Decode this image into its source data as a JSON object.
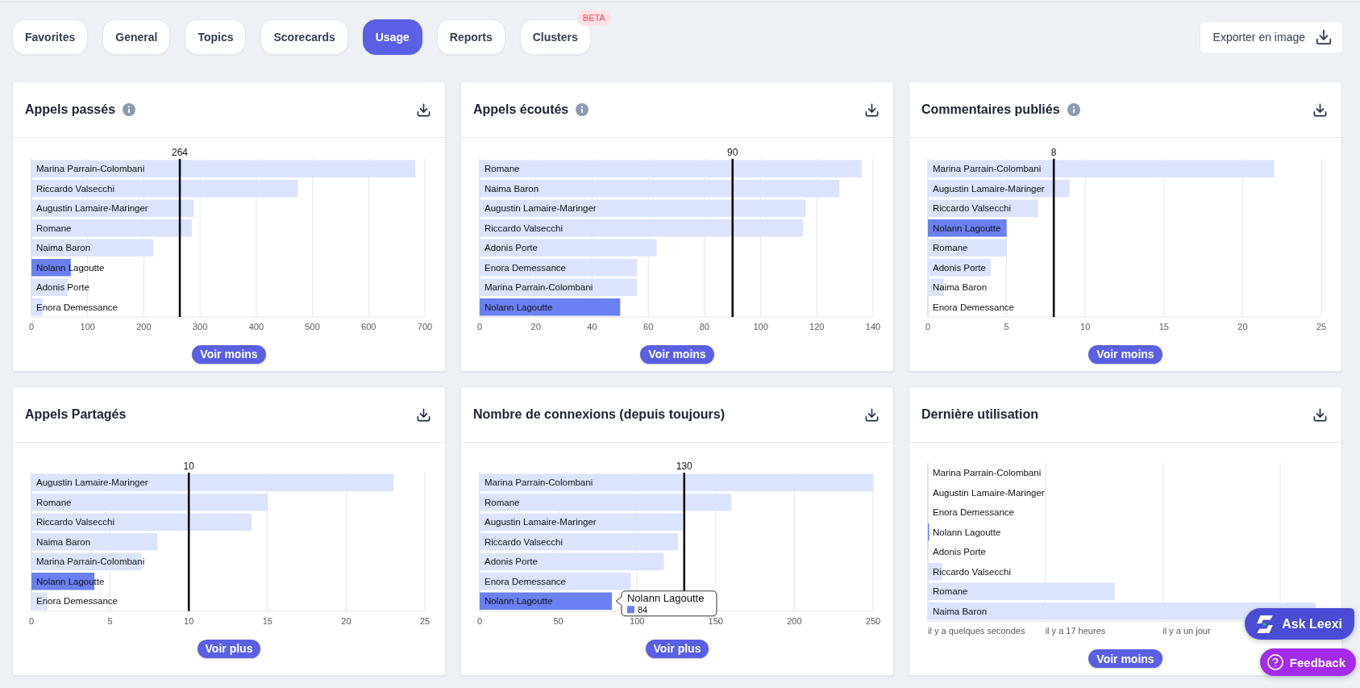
{
  "tabs": [
    {
      "label": "Favorites",
      "selected": false
    },
    {
      "label": "General",
      "selected": false
    },
    {
      "label": "Topics",
      "selected": false
    },
    {
      "label": "Scorecards",
      "selected": false
    },
    {
      "label": "Usage",
      "selected": true
    },
    {
      "label": "Reports",
      "selected": false
    },
    {
      "label": "Clusters",
      "selected": false,
      "badge": "BETA"
    }
  ],
  "export_button": {
    "label": "Exporter en image"
  },
  "cards": [
    {
      "title": "Appels passés",
      "info_icon": true,
      "chart_data": {
        "type": "bar",
        "orientation": "horizontal",
        "grid": true,
        "categories": [
          "Marina Parrain-Colombani",
          "Riccardo Valsecchi",
          "Augustin Lamaire-Maringer",
          "Romane",
          "Naima Baron",
          "Nolann Lagoutte",
          "Adonis Porte",
          "Enora Demessance"
        ],
        "series": [
          {
            "color": "#dbe3fd",
            "values": [
              683,
              474,
              289,
              285,
              217,
              null,
              64,
              20
            ]
          },
          {
            "color": "#6b80f2",
            "values": [
              null,
              null,
              null,
              null,
              null,
              70,
              null,
              null
            ]
          }
        ],
        "xlim": [
          0,
          700
        ],
        "xticks": [
          0,
          100,
          200,
          300,
          400,
          500,
          600,
          700
        ],
        "ref_lines": [
          {
            "axis": "x",
            "value": 264,
            "label": "264"
          }
        ]
      },
      "toggle": "Voir moins"
    },
    {
      "title": "Appels écoutés",
      "info_icon": true,
      "chart_data": {
        "type": "bar",
        "orientation": "horizontal",
        "grid": true,
        "categories": [
          "Romane",
          "Naima Baron",
          "Augustin Lamaire-Maringer",
          "Riccardo Valsecchi",
          "Adonis Porte",
          "Enora Demessance",
          "Marina Parrain-Colombani",
          "Nolann Lagoutte"
        ],
        "series": [
          {
            "color": "#dbe3fd",
            "values": [
              136,
              128,
              116,
              115,
              63,
              56,
              56,
              null
            ]
          },
          {
            "color": "#6b80f2",
            "values": [
              null,
              null,
              null,
              null,
              null,
              null,
              null,
              50
            ]
          }
        ],
        "xlim": [
          0,
          140
        ],
        "xticks": [
          0,
          20,
          40,
          60,
          80,
          100,
          120,
          140
        ],
        "ref_lines": [
          {
            "axis": "x",
            "value": 90,
            "label": "90"
          }
        ]
      },
      "toggle": "Voir moins"
    },
    {
      "title": "Commentaires publiés",
      "info_icon": true,
      "chart_data": {
        "type": "bar",
        "orientation": "horizontal",
        "grid": true,
        "categories": [
          "Marina Parrain-Colombani",
          "Augustin Lamaire-Maringer",
          "Riccardo Valsecchi",
          "Nolann Lagoutte",
          "Romane",
          "Adonis Porte",
          "Naima Baron",
          "Enora Demessance"
        ],
        "series": [
          {
            "color": "#dbe3fd",
            "values": [
              22,
              9,
              7,
              null,
              5,
              4,
              1,
              0
            ]
          },
          {
            "color": "#6b80f2",
            "values": [
              null,
              null,
              null,
              5,
              null,
              null,
              null,
              null
            ]
          }
        ],
        "xlim": [
          0,
          25
        ],
        "xticks": [
          0,
          5,
          10,
          15,
          20,
          25
        ],
        "ref_lines": [
          {
            "axis": "x",
            "value": 8,
            "label": "8"
          }
        ]
      },
      "toggle": "Voir moins"
    },
    {
      "title": "Appels Partagés",
      "info_icon": false,
      "chart_data": {
        "type": "bar",
        "orientation": "horizontal",
        "grid": true,
        "categories": [
          "Augustin Lamaire-Maringer",
          "Romane",
          "Riccardo Valsecchi",
          "Naima Baron",
          "Marina Parrain-Colombani",
          "Nolann Lagoutte",
          "Enora Demessance"
        ],
        "series": [
          {
            "color": "#dbe3fd",
            "values": [
              23,
              15,
              14,
              8,
              7,
              null,
              1
            ]
          },
          {
            "color": "#6b80f2",
            "values": [
              null,
              null,
              null,
              null,
              null,
              4,
              null
            ]
          }
        ],
        "xlim": [
          0,
          25
        ],
        "xticks": [
          0,
          5,
          10,
          15,
          20,
          25
        ],
        "ref_lines": [
          {
            "axis": "x",
            "value": 10,
            "label": "10"
          }
        ]
      },
      "toggle": "Voir plus"
    },
    {
      "title": "Nombre de connexions (depuis toujours)",
      "info_icon": false,
      "chart_data": {
        "type": "bar",
        "orientation": "horizontal",
        "grid": true,
        "categories": [
          "Marina Parrain-Colombani",
          "Romane",
          "Augustin Lamaire-Maringer",
          "Riccardo Valsecchi",
          "Adonis Porte",
          "Enora Demessance",
          "Nolann Lagoutte"
        ],
        "series": [
          {
            "color": "#dbe3fd",
            "values": [
              250,
              160,
              129,
              126,
              117,
              96,
              null
            ]
          },
          {
            "color": "#6b80f2",
            "values": [
              null,
              null,
              null,
              null,
              null,
              null,
              84
            ]
          }
        ],
        "xlim": [
          0,
          250
        ],
        "xticks": [
          0,
          50,
          100,
          150,
          200,
          250
        ],
        "ref_lines": [
          {
            "axis": "x",
            "value": 130,
            "label": "130"
          }
        ]
      },
      "tooltip": {
        "title": "Nolann Lagoutte",
        "value": "84"
      },
      "toggle": "Voir plus"
    },
    {
      "title": "Dernière utilisation",
      "info_icon": false,
      "timeline": {
        "bars": [
          {
            "label": "Marina Parrain-Colombani",
            "selected": false
          },
          {
            "label": "Augustin Lamaire-Maringer",
            "selected": false
          },
          {
            "label": "Enora Demessance",
            "selected": false
          },
          {
            "label": "Nolann Lagoutte",
            "selected": true
          },
          {
            "label": "Adonis Porte",
            "selected": false
          },
          {
            "label": "Riccardo Valsecchi",
            "selected": false
          },
          {
            "label": "Romane",
            "selected": false
          },
          {
            "label": "Naima Baron",
            "selected": false
          }
        ],
        "axis_labels": [
          "il y a quelques secondes",
          "il y a 17 heures",
          "il y a un jour"
        ]
      },
      "toggle": "Voir moins"
    }
  ],
  "floating_buttons": [
    {
      "kind": "assistant",
      "label": "Ask Leexi"
    },
    {
      "kind": "feedback",
      "label": "Feedback"
    }
  ]
}
